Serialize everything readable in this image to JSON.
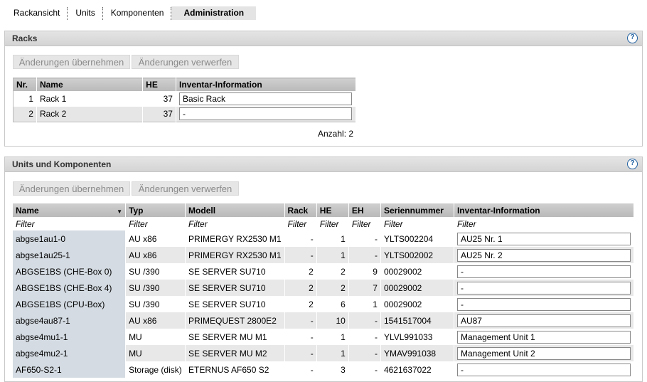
{
  "tabs": [
    {
      "label": "Rackansicht",
      "active": false
    },
    {
      "label": "Units",
      "active": false
    },
    {
      "label": "Komponenten",
      "active": false
    },
    {
      "label": "Administration",
      "active": true
    }
  ],
  "racks_panel": {
    "title": "Racks",
    "apply_label": "Änderungen übernehmen",
    "discard_label": "Änderungen verwerfen",
    "columns": [
      "Nr.",
      "Name",
      "HE",
      "Inventar-Information"
    ],
    "rows": [
      {
        "nr": "1",
        "name": "Rack 1",
        "he": "37",
        "inventory": "Basic Rack"
      },
      {
        "nr": "2",
        "name": "Rack 2",
        "he": "37",
        "inventory": "-"
      }
    ],
    "count_label": "Anzahl: 2"
  },
  "units_panel": {
    "title": "Units und Komponenten",
    "apply_label": "Änderungen übernehmen",
    "discard_label": "Änderungen verwerfen",
    "columns": [
      "Name",
      "Typ",
      "Modell",
      "Rack",
      "HE",
      "EH",
      "Seriennummer",
      "Inventar-Information"
    ],
    "filter_label": "Filter",
    "rows": [
      {
        "name": "abgse1au1-0",
        "typ": "AU x86",
        "modell": "PRIMERGY RX2530 M1",
        "rack": "-",
        "he": "1",
        "eh": "-",
        "serial": "YLTS002204",
        "inventory": "AU25 Nr. 1"
      },
      {
        "name": "abgse1au25-1",
        "typ": "AU x86",
        "modell": "PRIMERGY RX2530 M1",
        "rack": "-",
        "he": "1",
        "eh": "-",
        "serial": "YLTS002002",
        "inventory": "AU25 Nr. 2"
      },
      {
        "name": "ABGSE1BS (CHE-Box 0)",
        "typ": "SU /390",
        "modell": "SE SERVER SU710",
        "rack": "2",
        "he": "2",
        "eh": "9",
        "serial": "00029002",
        "inventory": "-"
      },
      {
        "name": "ABGSE1BS (CHE-Box 4)",
        "typ": "SU /390",
        "modell": "SE SERVER SU710",
        "rack": "2",
        "he": "2",
        "eh": "7",
        "serial": "00029002",
        "inventory": "-"
      },
      {
        "name": "ABGSE1BS (CPU-Box)",
        "typ": "SU /390",
        "modell": "SE SERVER SU710",
        "rack": "2",
        "he": "6",
        "eh": "1",
        "serial": "00029002",
        "inventory": "-"
      },
      {
        "name": "abgse4au87-1",
        "typ": "AU x86",
        "modell": "PRIMEQUEST 2800E2",
        "rack": "-",
        "he": "10",
        "eh": "-",
        "serial": "1541517004",
        "inventory": "AU87"
      },
      {
        "name": "abgse4mu1-1",
        "typ": "MU",
        "modell": "SE SERVER MU M1",
        "rack": "-",
        "he": "1",
        "eh": "-",
        "serial": "YLVL991033",
        "inventory": "Management Unit 1"
      },
      {
        "name": "abgse4mu2-1",
        "typ": "MU",
        "modell": "SE SERVER MU M2",
        "rack": "-",
        "he": "1",
        "eh": "-",
        "serial": "YMAV991038",
        "inventory": "Management Unit 2"
      },
      {
        "name": "AF650-S2-1",
        "typ": "Storage (disk)",
        "modell": "ETERNUS AF650 S2",
        "rack": "-",
        "he": "3",
        "eh": "-",
        "serial": "4621637022",
        "inventory": "-"
      }
    ]
  },
  "icons": {
    "help": "help-icon",
    "sort": "sort-desc-icon"
  }
}
